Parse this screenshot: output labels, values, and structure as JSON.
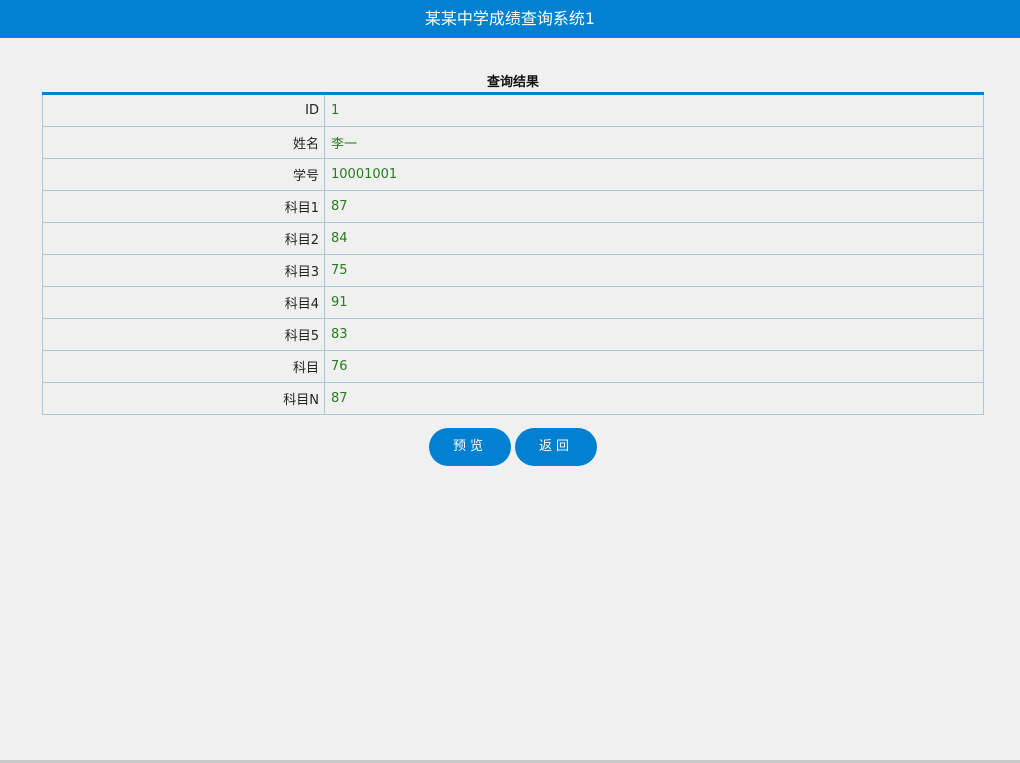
{
  "header": {
    "title": "某某中学成绩查询系统1"
  },
  "result": {
    "caption": "查询结果",
    "rows": [
      {
        "label": "ID",
        "value": "1"
      },
      {
        "label": "姓名",
        "value": "李一"
      },
      {
        "label": "学号",
        "value": "10001001"
      },
      {
        "label": "科目1",
        "value": "87"
      },
      {
        "label": "科目2",
        "value": "84"
      },
      {
        "label": "科目3",
        "value": "75"
      },
      {
        "label": "科目4",
        "value": "91"
      },
      {
        "label": "科目5",
        "value": "83"
      },
      {
        "label": "科目",
        "value": "76"
      },
      {
        "label": "科目N",
        "value": "87"
      }
    ]
  },
  "actions": {
    "preview_label": "预览",
    "back_label": "返回"
  },
  "colors": {
    "accent": "#0080d0",
    "value_text": "#2a7a20",
    "border": "#a8c8e0"
  }
}
